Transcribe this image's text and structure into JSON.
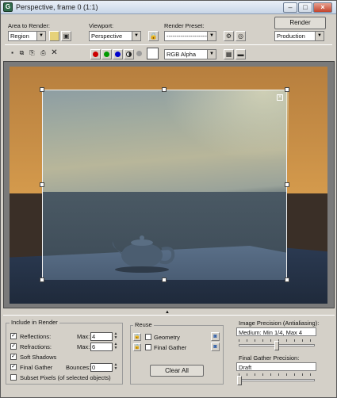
{
  "window": {
    "title": "Perspective, frame 0 (1:1)",
    "icon_glyph": "G",
    "minimize": "–",
    "maximize": "□",
    "close": "×"
  },
  "toolbar": {
    "area_label": "Area to Render:",
    "area_value": "Region",
    "viewport_label": "Viewport:",
    "viewport_value": "Perspective",
    "preset_label": "Render Preset:",
    "preset_value": "-----------------------",
    "render_button": "Render",
    "production_value": "Production",
    "display_value": "RGB Alpha",
    "lock_glyph": "🔒",
    "clear_glyph": "✕"
  },
  "channels": {
    "red": "#cc0000",
    "green": "#009900",
    "blue": "#0000cc",
    "alpha_icon": "half-circle-icon",
    "mono_icon": "gray-dot-icon"
  },
  "bottom": {
    "include_title": "Include in Render",
    "reflections_label": "Reflections:",
    "reflections_max_label": "Max:",
    "reflections_max": "4",
    "refractions_label": "Refractions:",
    "refractions_max_label": "Max:",
    "refractions_max": "6",
    "soft_shadows_label": "Soft Shadows",
    "final_gather_label": "Final Gather",
    "bounces_label": "Bounces:",
    "bounces_value": "0",
    "subset_label": "Subset Pixels (of selected objects)",
    "reuse_title": "Reuse",
    "geometry_label": "Geometry",
    "reuse_fg_label": "Final Gather",
    "clear_all": "Clear All",
    "precision_title": "Image Precision (Antialiasing):",
    "precision_value": "Medium: Min 1/4, Max 4",
    "fg_precision_title": "Final Gather Precision:",
    "fg_precision_value": "Draft"
  },
  "checked": "✓",
  "colors": {
    "accent": "#d4d0c8",
    "sky": "#c68d46"
  },
  "sliders": {
    "antialiasing_level": 0.5,
    "final_gather_level": 0.0
  }
}
